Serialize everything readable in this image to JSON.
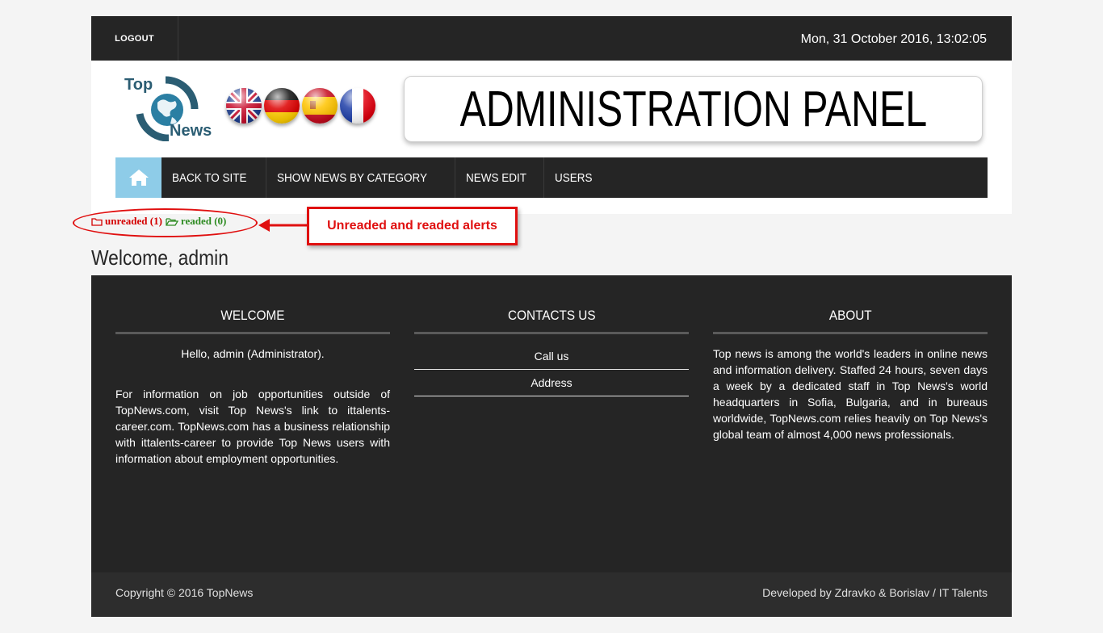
{
  "topbar": {
    "logout_label": "LOGOUT",
    "datetime": "Mon, 31 October 2016, 13:02:05"
  },
  "header": {
    "logo_top": "Top",
    "logo_news": "News",
    "flags": [
      "uk-flag-icon",
      "germany-flag-icon",
      "spain-flag-icon",
      "france-flag-icon"
    ],
    "banner_title": "ADMINISTRATION PANEL"
  },
  "nav": {
    "home_icon": "home-icon",
    "items": [
      {
        "label": "BACK TO SITE"
      },
      {
        "label": "SHOW NEWS BY CATEGORY"
      },
      {
        "label": "NEWS EDIT"
      },
      {
        "label": "USERS"
      }
    ]
  },
  "alerts": {
    "unread_label": "unreaded (1)",
    "read_label": "readed (0)",
    "unread_color": "#d40000",
    "read_color": "#2e8b22",
    "annotation": "Unreaded and readed alerts"
  },
  "main": {
    "welcome_title": "Welcome, admin"
  },
  "footer": {
    "welcome": {
      "title": "WELCOME",
      "hello": "Hello, admin (Administrator).",
      "info": "For information on job opportunities outside of TopNews.com, visit Top News's link to ittalents-career.com. TopNews.com has a business relationship with ittalents-career to provide Top News users with information about employment opportunities."
    },
    "contacts": {
      "title": "CONTACTS US",
      "links": [
        {
          "label": "Call us"
        },
        {
          "label": "Address"
        }
      ]
    },
    "about": {
      "title": "ABOUT",
      "text": "Top news is among the world's leaders in online news and information delivery. Staffed 24 hours, seven days a week by a dedicated staff in Top News's world headquarters in Sofia, Bulgaria, and in bureaus worldwide, TopNews.com relies heavily on Top News's global team of almost 4,000 news professionals."
    },
    "copyright": "Copyright © 2016 TopNews",
    "developed_by": "Developed by Zdravko & Borislav / IT Talents"
  }
}
